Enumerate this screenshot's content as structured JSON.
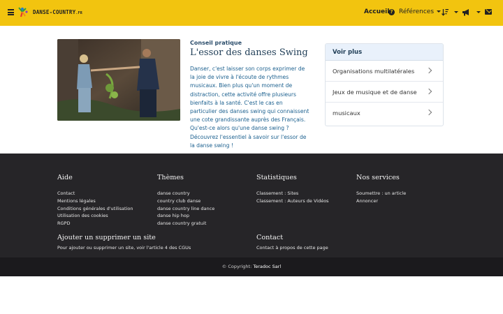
{
  "navbar": {
    "logo_text": "DANSE-COUNTRY",
    "logo_tld": ".FR",
    "home": "Accueil",
    "help_glyph": "?",
    "references": "Références",
    "icons": [
      "menu-icon",
      "help-circle-icon",
      "sort-icon",
      "megaphone-icon",
      "envelope-icon"
    ],
    "accent_color": "#f2c40f"
  },
  "article": {
    "eyebrow": "Conseil pratique",
    "title": "L'essor des danses Swing",
    "body": "Danser, c'est laisser son corps exprimer de la joie de vivre à l'écoute de rythmes musicaux. Bien plus qu'un moment de distraction, cette activité offre plusieurs bienfaits à la santé. C'est le cas en particulier des danses swing qui connaissent une cote grandissante auprès des Français. Qu'est-ce alors qu'une danse swing ? Découvrez l'essentiel à savoir sur l'essor de la danse swing !"
  },
  "voir_plus": {
    "title": "Voir plus",
    "items": [
      {
        "label": "Organisations multilatérales"
      },
      {
        "label": "Jeux de musique et de danse"
      },
      {
        "label": "musicaux"
      }
    ]
  },
  "footer": {
    "aide": {
      "title": "Aide",
      "links": [
        "Contact",
        "Mentions légales",
        "Conditions générales d'utilisation",
        "Utilisation des cookies",
        "RGPD"
      ]
    },
    "themes": {
      "title": "Thèmes",
      "links": [
        "danse country",
        "country club danse",
        "danse country line dance",
        "danse hip hop",
        "danse country gratuit"
      ]
    },
    "statistiques": {
      "title": "Statistiques",
      "links": [
        "Classement : Sites",
        "Classement : Auteurs de Vidéos"
      ]
    },
    "services": {
      "title": "Nos services",
      "links": [
        "Soumettre : un article",
        "Annoncer"
      ]
    },
    "ajouter": {
      "title": "Ajouter un supprimer un site",
      "text": "Pour ajouter ou supprimer un site, voir l'article 4 des CGUs"
    },
    "contact": {
      "title": "Contact",
      "text": "Contact à propos de cette page"
    }
  },
  "copyright": {
    "prefix": "© Copyright: ",
    "brand": "Teradoc Sarl"
  }
}
